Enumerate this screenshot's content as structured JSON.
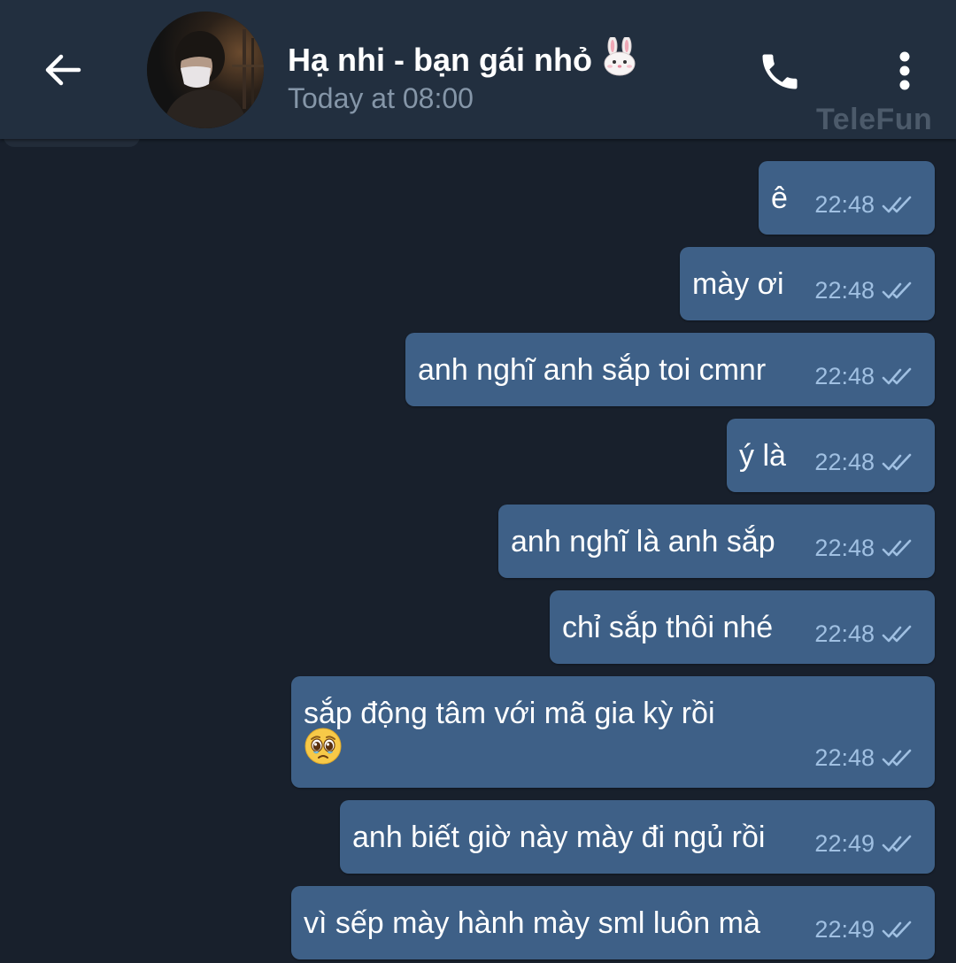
{
  "header": {
    "title": "Hạ nhi - bạn gái nhỏ",
    "subtitle": "Today at 08:00",
    "watermark": "TeleFun",
    "icons": {
      "back": "arrow-left-icon",
      "call": "phone-icon",
      "menu": "more-vert-icon",
      "title_emoji": "rabbit-face-emoji"
    }
  },
  "messages": [
    {
      "text": "ê",
      "time": "22:48"
    },
    {
      "text": "mày ơi",
      "time": "22:48"
    },
    {
      "text": "anh nghĩ anh sắp toi cmnr",
      "time": "22:48"
    },
    {
      "text": "ý là",
      "time": "22:48"
    },
    {
      "text": "anh nghĩ là anh sắp",
      "time": "22:48"
    },
    {
      "text": "chỉ sắp thôi nhé",
      "time": "22:48"
    },
    {
      "text": "sắp động tâm với mã gia kỳ rồi",
      "time": "22:48",
      "emoji": "pleading-face-emoji"
    },
    {
      "text": "anh biết giờ này mày đi ngủ rồi",
      "time": "22:49"
    },
    {
      "text": "vì sếp mày hành mày sml luôn mà",
      "time": "22:49"
    }
  ],
  "colors": {
    "background": "#18202c",
    "header": "#222f3f",
    "bubble": "#3e6087",
    "time": "#a0c0e2",
    "subtitle": "#8596a8"
  }
}
